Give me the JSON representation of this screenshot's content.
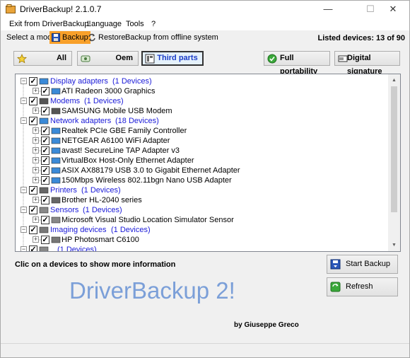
{
  "window": {
    "title": "DriverBackup! 2.1.0.7",
    "minimize": "—",
    "maximize": "☐",
    "close": "✕"
  },
  "menu": {
    "items": [
      {
        "label": "Exit from DriverBackup!"
      },
      {
        "label": "Language"
      },
      {
        "label": "Tools"
      },
      {
        "label": "?"
      }
    ]
  },
  "mode": {
    "label": "Select a mode",
    "backup": "Backup",
    "restore": "Restore",
    "offline": "Backup from offline system",
    "listed": "Listed devices: 13 of 90"
  },
  "filters": {
    "all": "All",
    "oem": "Oem",
    "third_parts": "Third parts",
    "full_portability": "Full portability",
    "digital_signature": "Digital signature"
  },
  "tree": {
    "categories": [
      {
        "name": "Display adapters",
        "count": "(1 Devices)",
        "devices": [
          "ATI Radeon 3000 Graphics"
        ]
      },
      {
        "name": "Modems",
        "count": "(1 Devices)",
        "devices": [
          "SAMSUNG Mobile USB Modem"
        ]
      },
      {
        "name": "Network adapters",
        "count": "(18 Devices)",
        "devices": [
          "Realtek PCIe GBE Family Controller",
          "NETGEAR A6100 WiFi Adapter",
          "avast! SecureLine TAP Adapter v3",
          "VirtualBox Host-Only Ethernet Adapter",
          "ASIX AX88179 USB 3.0 to Gigabit Ethernet Adapter",
          "150Mbps Wireless 802.11bgn Nano USB Adapter"
        ]
      },
      {
        "name": "Printers",
        "count": "(1 Devices)",
        "devices": [
          "Brother HL-2040 series"
        ]
      },
      {
        "name": "Sensors",
        "count": "(1 Devices)",
        "devices": [
          "Microsoft Visual Studio Location Simulator Sensor"
        ]
      },
      {
        "name": "Imaging devices",
        "count": "(1 Devices)",
        "devices": [
          "HP Photosmart C6100"
        ]
      },
      {
        "name": "",
        "count": "(1 Devices)",
        "devices": []
      }
    ]
  },
  "info": "Clic on a devices to show more information",
  "brand": "DriverBackup 2!",
  "author": "by Giuseppe Greco",
  "actions": {
    "start_backup": "Start Backup",
    "refresh": "Refresh"
  },
  "colors": {
    "accent": "#f8a02a",
    "link": "#1a1ad8",
    "brand": "#7b9fd8"
  }
}
